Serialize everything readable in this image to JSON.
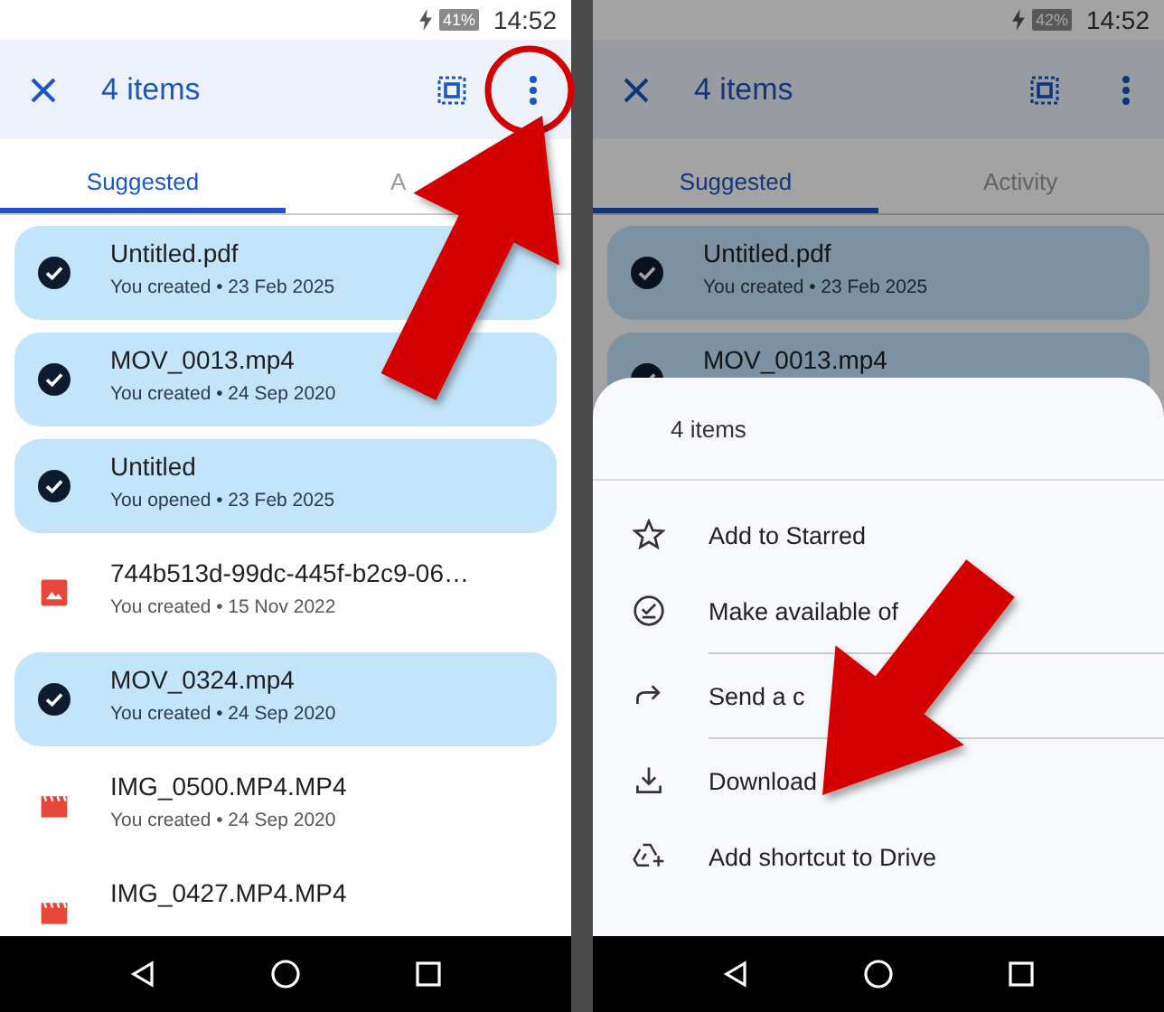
{
  "panels": [
    {
      "dimmed": false,
      "status_bar": {
        "battery": "41%",
        "time": "14:52"
      },
      "app_bar": {
        "title": "4 items"
      },
      "tabs": [
        {
          "label": "Suggested",
          "selected": true
        },
        {
          "label": "A",
          "selected": false
        }
      ],
      "files": [
        {
          "name": "Untitled.pdf",
          "meta": "You created • 23 Feb 2025",
          "selected": true
        },
        {
          "name": "MOV_0013.mp4",
          "meta": "You created • 24 Sep 2020",
          "selected": true
        },
        {
          "name": "Untitled",
          "meta": "You opened • 23 Feb 2025",
          "selected": true
        },
        {
          "name": "744b513d-99dc-445f-b2c9-06…",
          "meta": "You created • 15 Nov 2022",
          "selected": false,
          "kind": "image"
        },
        {
          "name": "MOV_0324.mp4",
          "meta": "You created • 24 Sep 2020",
          "selected": true
        },
        {
          "name": "IMG_0500.MP4.MP4",
          "meta": "You created • 24 Sep 2020",
          "selected": false,
          "kind": "video"
        },
        {
          "name": "IMG_0427.MP4.MP4",
          "selected": false,
          "kind": "video"
        }
      ]
    },
    {
      "dimmed": true,
      "status_bar": {
        "battery": "42%",
        "time": "14:52"
      },
      "app_bar": {
        "title": "4 items"
      },
      "tabs": [
        {
          "label": "Suggested",
          "selected": true
        },
        {
          "label": "Activity",
          "selected": false
        }
      ],
      "files": [
        {
          "name": "Untitled.pdf",
          "meta": "You created • 23 Feb 2025",
          "selected": true
        },
        {
          "name": "MOV_0013.mp4",
          "selected": true
        }
      ],
      "sheet": {
        "title": "4 items",
        "sections": [
          {
            "items": [
              {
                "label": "Add to Starred",
                "kind": "star"
              },
              {
                "label": "Make available of",
                "kind": "offline"
              }
            ]
          },
          {
            "items": [
              {
                "label": "Send a c",
                "kind": "share"
              }
            ]
          },
          {
            "items": [
              {
                "label": "Download",
                "kind": "download"
              },
              {
                "label": "Add shortcut to Drive",
                "kind": "shortcut"
              }
            ]
          }
        ]
      }
    }
  ]
}
